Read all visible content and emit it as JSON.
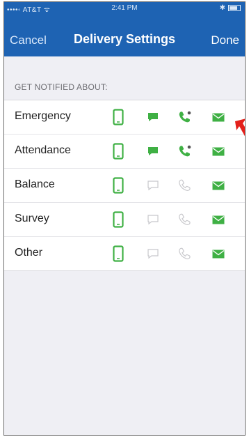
{
  "status_bar": {
    "carrier": "••••◦ AT&T ᯤ",
    "time": "2:41 PM"
  },
  "nav": {
    "cancel_label": "Cancel",
    "title": "Delivery Settings",
    "done_label": "Done"
  },
  "section_header": "GET NOTIFIED ABOUT:",
  "colors": {
    "accent_blue": "#1e63b3",
    "active_green": "#3fb044",
    "inactive_gray": "#c8c8cc",
    "arrow_red": "#e3201b"
  },
  "rows": [
    {
      "label": "Emergency",
      "phone": true,
      "sms": true,
      "call": true,
      "email": true
    },
    {
      "label": "Attendance",
      "phone": true,
      "sms": true,
      "call": true,
      "email": true
    },
    {
      "label": "Balance",
      "phone": true,
      "sms": false,
      "call": false,
      "email": true
    },
    {
      "label": "Survey",
      "phone": true,
      "sms": false,
      "call": false,
      "email": true
    },
    {
      "label": "Other",
      "phone": true,
      "sms": false,
      "call": false,
      "email": true
    }
  ],
  "icons": {
    "phone": "mobile-phone-icon",
    "sms": "text-message-icon",
    "call": "phone-call-icon",
    "email": "email-icon",
    "arrow": "red-arrow-icon"
  }
}
